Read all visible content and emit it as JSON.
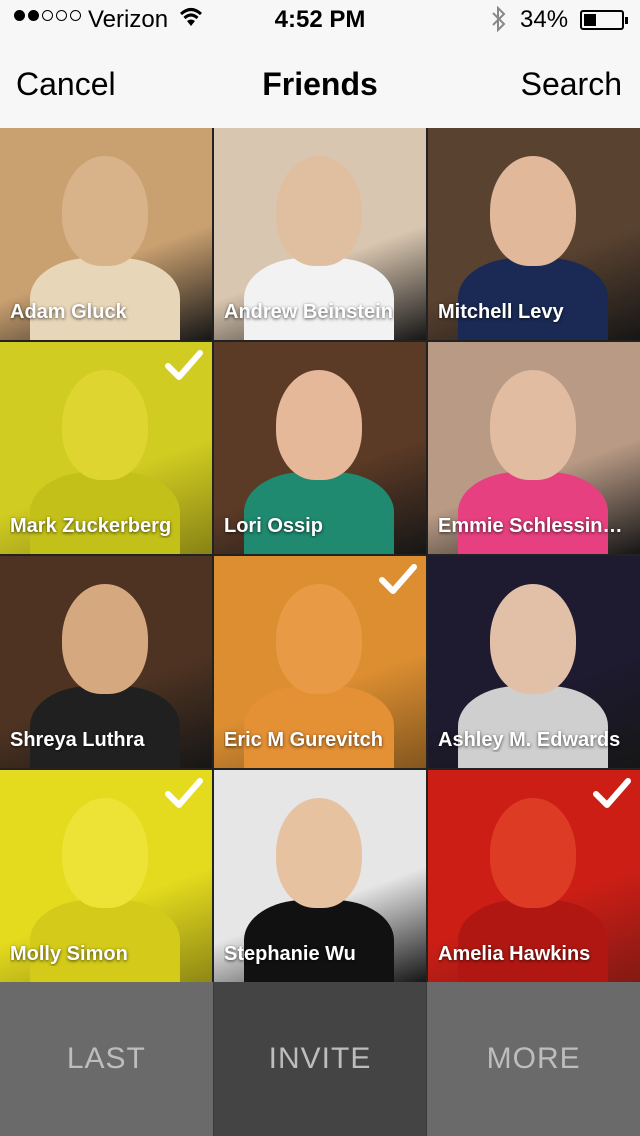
{
  "status_bar": {
    "carrier": "Verizon",
    "time": "4:52 PM",
    "battery": "34%",
    "battery_fraction": 0.34,
    "signal_bars_filled": 2,
    "signal_bars_total": 5
  },
  "nav": {
    "cancel": "Cancel",
    "title": "Friends",
    "search": "Search"
  },
  "friends": [
    {
      "name": "Adam Gluck",
      "selected": false,
      "bg": "#c9a070",
      "skin": "#d8b38a",
      "shirt": "#e8d6b8",
      "tint": ""
    },
    {
      "name": "Andrew Beinstein",
      "selected": false,
      "bg": "#d9c6b0",
      "skin": "#e0bfa0",
      "shirt": "#f2f2f2",
      "tint": ""
    },
    {
      "name": "Mitchell Levy",
      "selected": false,
      "bg": "#5a4230",
      "skin": "#e1b89a",
      "shirt": "#1a2a55",
      "tint": ""
    },
    {
      "name": "Mark Zuckerberg",
      "selected": true,
      "bg": "#b7b832",
      "skin": "#d8cc55",
      "shirt": "#9aa020",
      "tint": "rgba(230,220,20,0.55)"
    },
    {
      "name": "Lori Ossip",
      "selected": false,
      "bg": "#5b3a26",
      "skin": "#e5b89a",
      "shirt": "#1f8a70",
      "tint": ""
    },
    {
      "name": "Emmie Schlessinger",
      "selected": false,
      "bg": "#b89a85",
      "skin": "#e2bca0",
      "shirt": "#e64080",
      "tint": ""
    },
    {
      "name": "Shreya Luthra",
      "selected": false,
      "bg": "#4e3322",
      "skin": "#d6a880",
      "shirt": "#202020",
      "tint": ""
    },
    {
      "name": "Eric M Gurevitch",
      "selected": true,
      "bg": "#c8863a",
      "skin": "#e0a060",
      "shirt": "#d88a40",
      "tint": "rgba(240,150,40,0.5)"
    },
    {
      "name": "Ashley M. Edwards",
      "selected": false,
      "bg": "#1e1a30",
      "skin": "#e2c0a8",
      "shirt": "#cfcfcf",
      "tint": ""
    },
    {
      "name": "Molly Simon",
      "selected": true,
      "bg": "#d6cf2a",
      "skin": "#e8df60",
      "shirt": "#b0a820",
      "tint": "rgba(240,230,20,0.55)"
    },
    {
      "name": "Stephanie Wu",
      "selected": false,
      "bg": "#e6e6e6",
      "skin": "#e6c2a0",
      "shirt": "#111111",
      "tint": ""
    },
    {
      "name": "Amelia Hawkins",
      "selected": true,
      "bg": "#b82018",
      "skin": "#e0603a",
      "shirt": "#7a1010",
      "tint": "rgba(220,30,20,0.55)"
    }
  ],
  "bottom_bar": {
    "last": "LAST",
    "invite": "INVITE",
    "more": "MORE"
  }
}
